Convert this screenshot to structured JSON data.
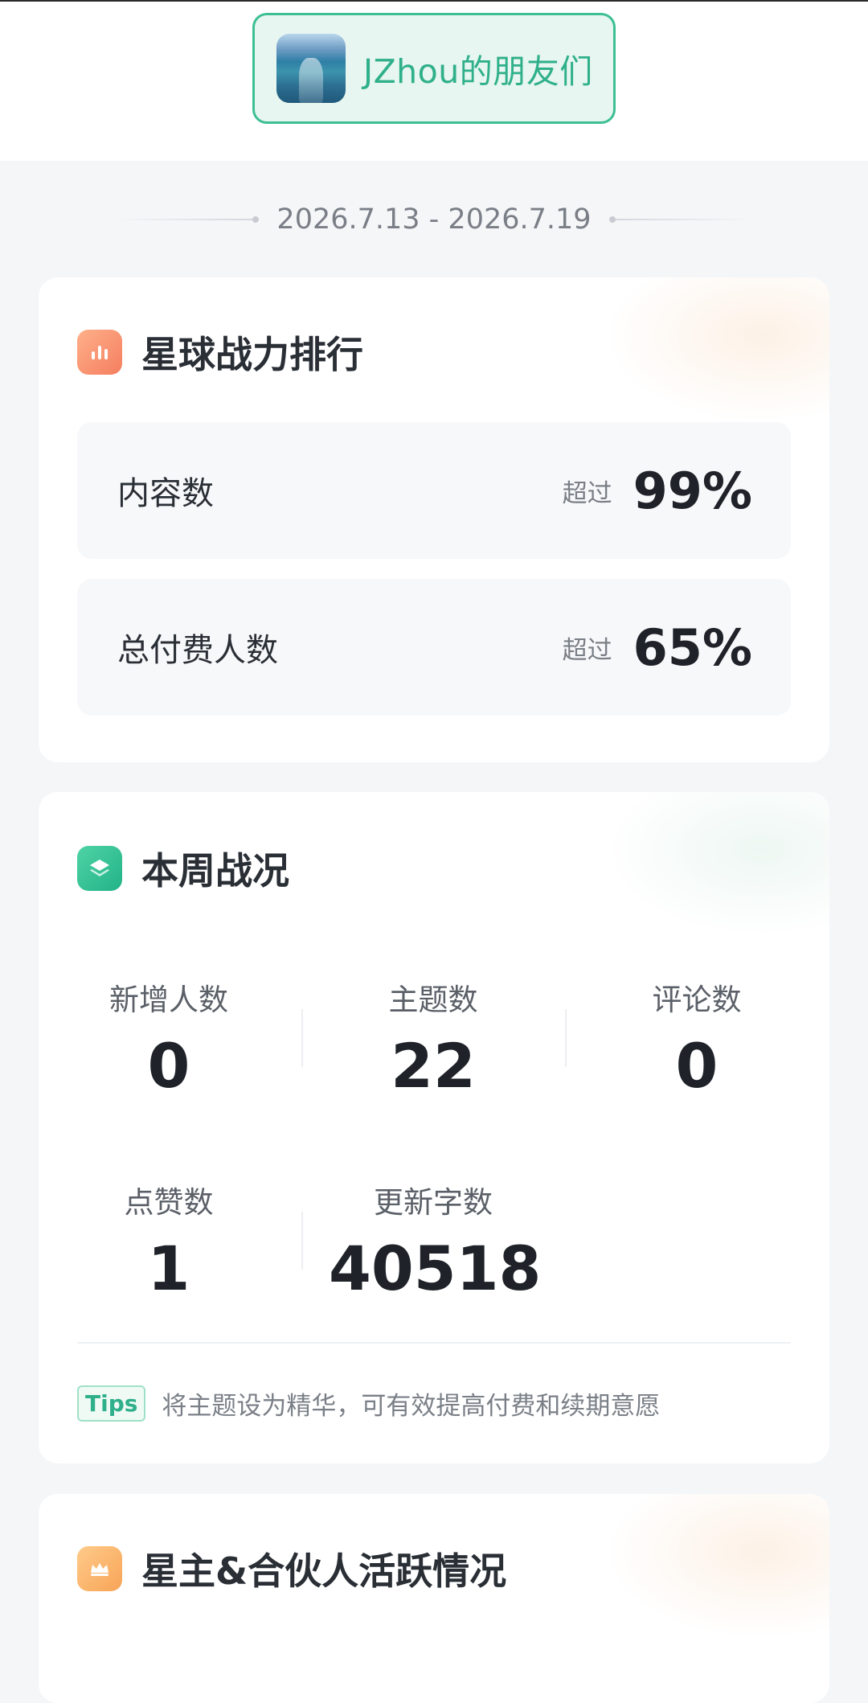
{
  "header": {
    "group_name": "JZhou的朋友们",
    "avatar_icon": "ocean-wake-avatar"
  },
  "date_range": "2026.7.13 - 2026.7.19",
  "ranking_card": {
    "icon": "bar-chart-icon",
    "title": "星球战力排行",
    "rows": [
      {
        "label": "内容数",
        "prefix": "超过",
        "value": "99%"
      },
      {
        "label": "总付费人数",
        "prefix": "超过",
        "value": "65%"
      }
    ]
  },
  "weekly_card": {
    "icon": "layers-icon",
    "title": "本周战况",
    "stats": [
      {
        "label": "新增人数",
        "value": "0"
      },
      {
        "label": "主题数",
        "value": "22"
      },
      {
        "label": "评论数",
        "value": "0"
      },
      {
        "label": "点赞数",
        "value": "1"
      },
      {
        "label": "更新字数",
        "value": "40518"
      }
    ],
    "tips_badge": "Tips",
    "tips_text": "将主题设为精华，可有效提高付费和续期意愿"
  },
  "activity_card": {
    "icon": "crown-icon",
    "title": "星主&合伙人活跃情况"
  },
  "colors": {
    "accent_green": "#2fb08a",
    "orange_icon": "#f47e5f",
    "amber_icon": "#f7a457"
  }
}
